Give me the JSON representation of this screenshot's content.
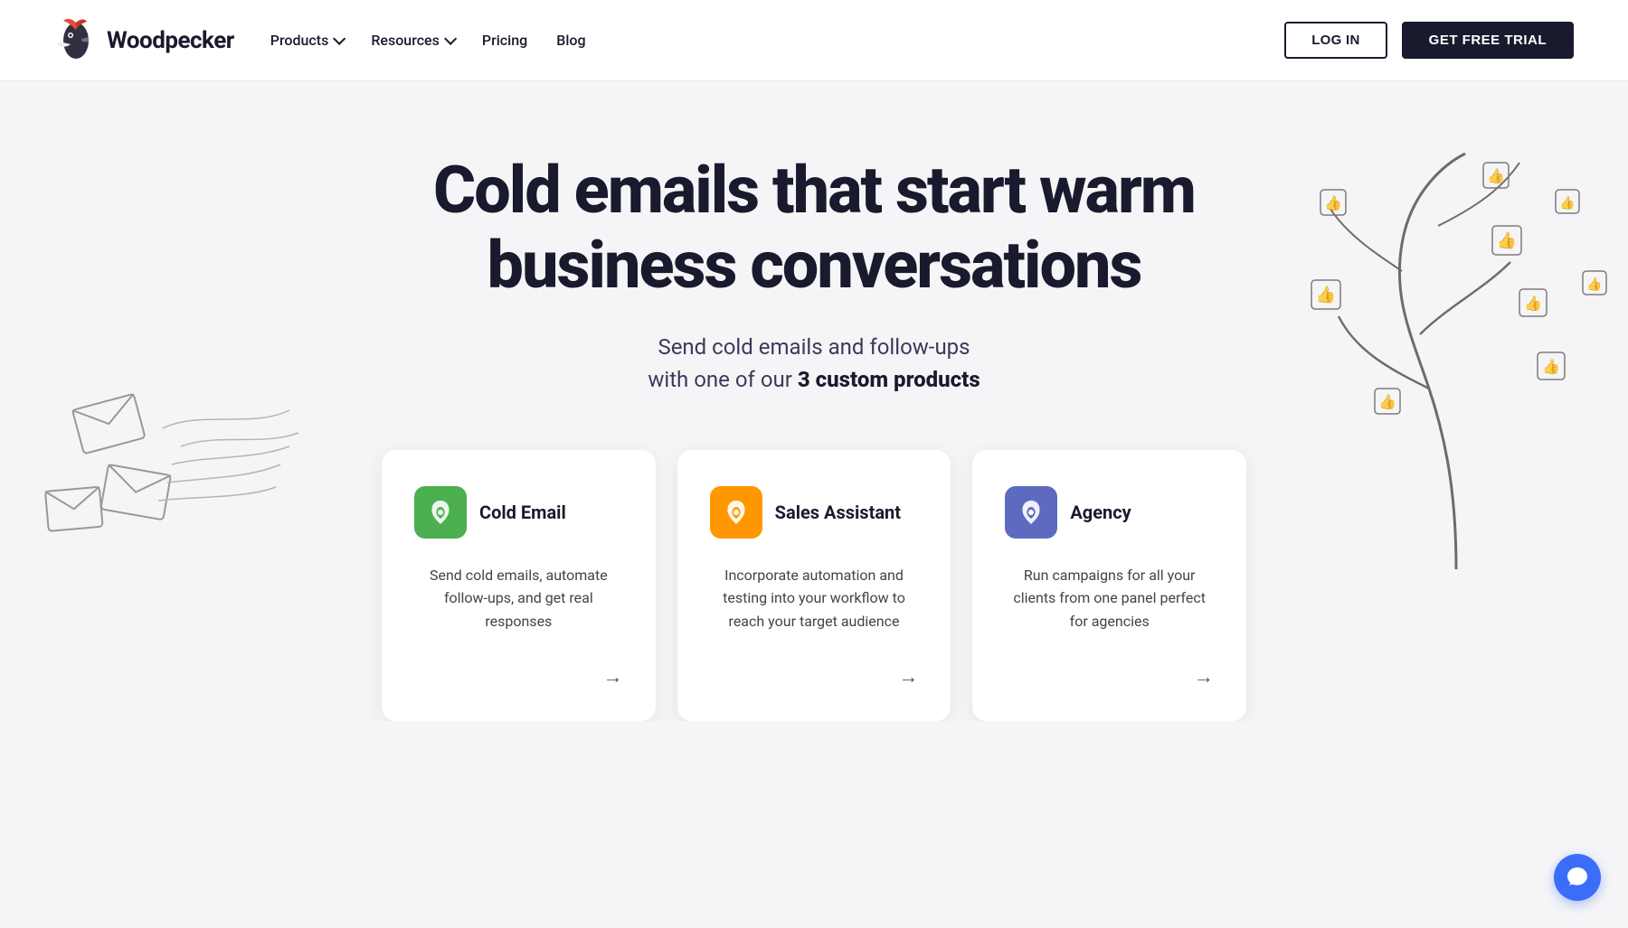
{
  "navbar": {
    "brand": "Woodpecker",
    "nav_items": [
      {
        "label": "Products",
        "has_dropdown": true
      },
      {
        "label": "Resources",
        "has_dropdown": true
      },
      {
        "label": "Pricing",
        "has_dropdown": false
      },
      {
        "label": "Blog",
        "has_dropdown": false
      }
    ],
    "login_label": "LOG IN",
    "trial_label": "GET FREE TRIAL"
  },
  "hero": {
    "title": "Cold emails that start warm business conversations",
    "subtitle_part1": "Send cold emails and follow-ups",
    "subtitle_part2": "with one of our",
    "subtitle_strong": "3 custom products"
  },
  "cards": [
    {
      "id": "cold-email",
      "title": "Cold Email",
      "description": "Send cold emails, automate follow-ups, and get real responses",
      "icon_color": "green",
      "arrow": "→"
    },
    {
      "id": "sales-assistant",
      "title": "Sales Assistant",
      "description": "Incorporate automation and testing into your workflow to reach your target audience",
      "icon_color": "orange",
      "arrow": "→"
    },
    {
      "id": "agency",
      "title": "Agency",
      "description": "Run campaigns for all your clients from one panel perfect for agencies",
      "icon_color": "blue",
      "arrow": "→"
    }
  ],
  "chat": {
    "label": "Chat support"
  }
}
